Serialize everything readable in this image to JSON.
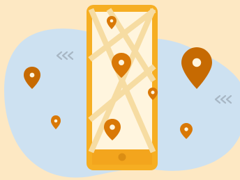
{
  "colors": {
    "background": "#FDE8C3",
    "blob": "#CDE1F1",
    "phone_body": "#F6AE22",
    "phone_screen": "#FFF5DE",
    "phone_bottom_bar": "#F3A51D",
    "home_button": "#DB8E13",
    "map_roads": "#F6DCA2",
    "pin_primary": "#D97806",
    "pin_dark": "#C66A02",
    "pin_dot": "#FFF5DE",
    "chevrons": "#A7B6C4"
  },
  "icons": {
    "phone": "smartphone-icon",
    "pin": "map-pin-icon",
    "chevrons": "triple-chevron-left-icon"
  }
}
